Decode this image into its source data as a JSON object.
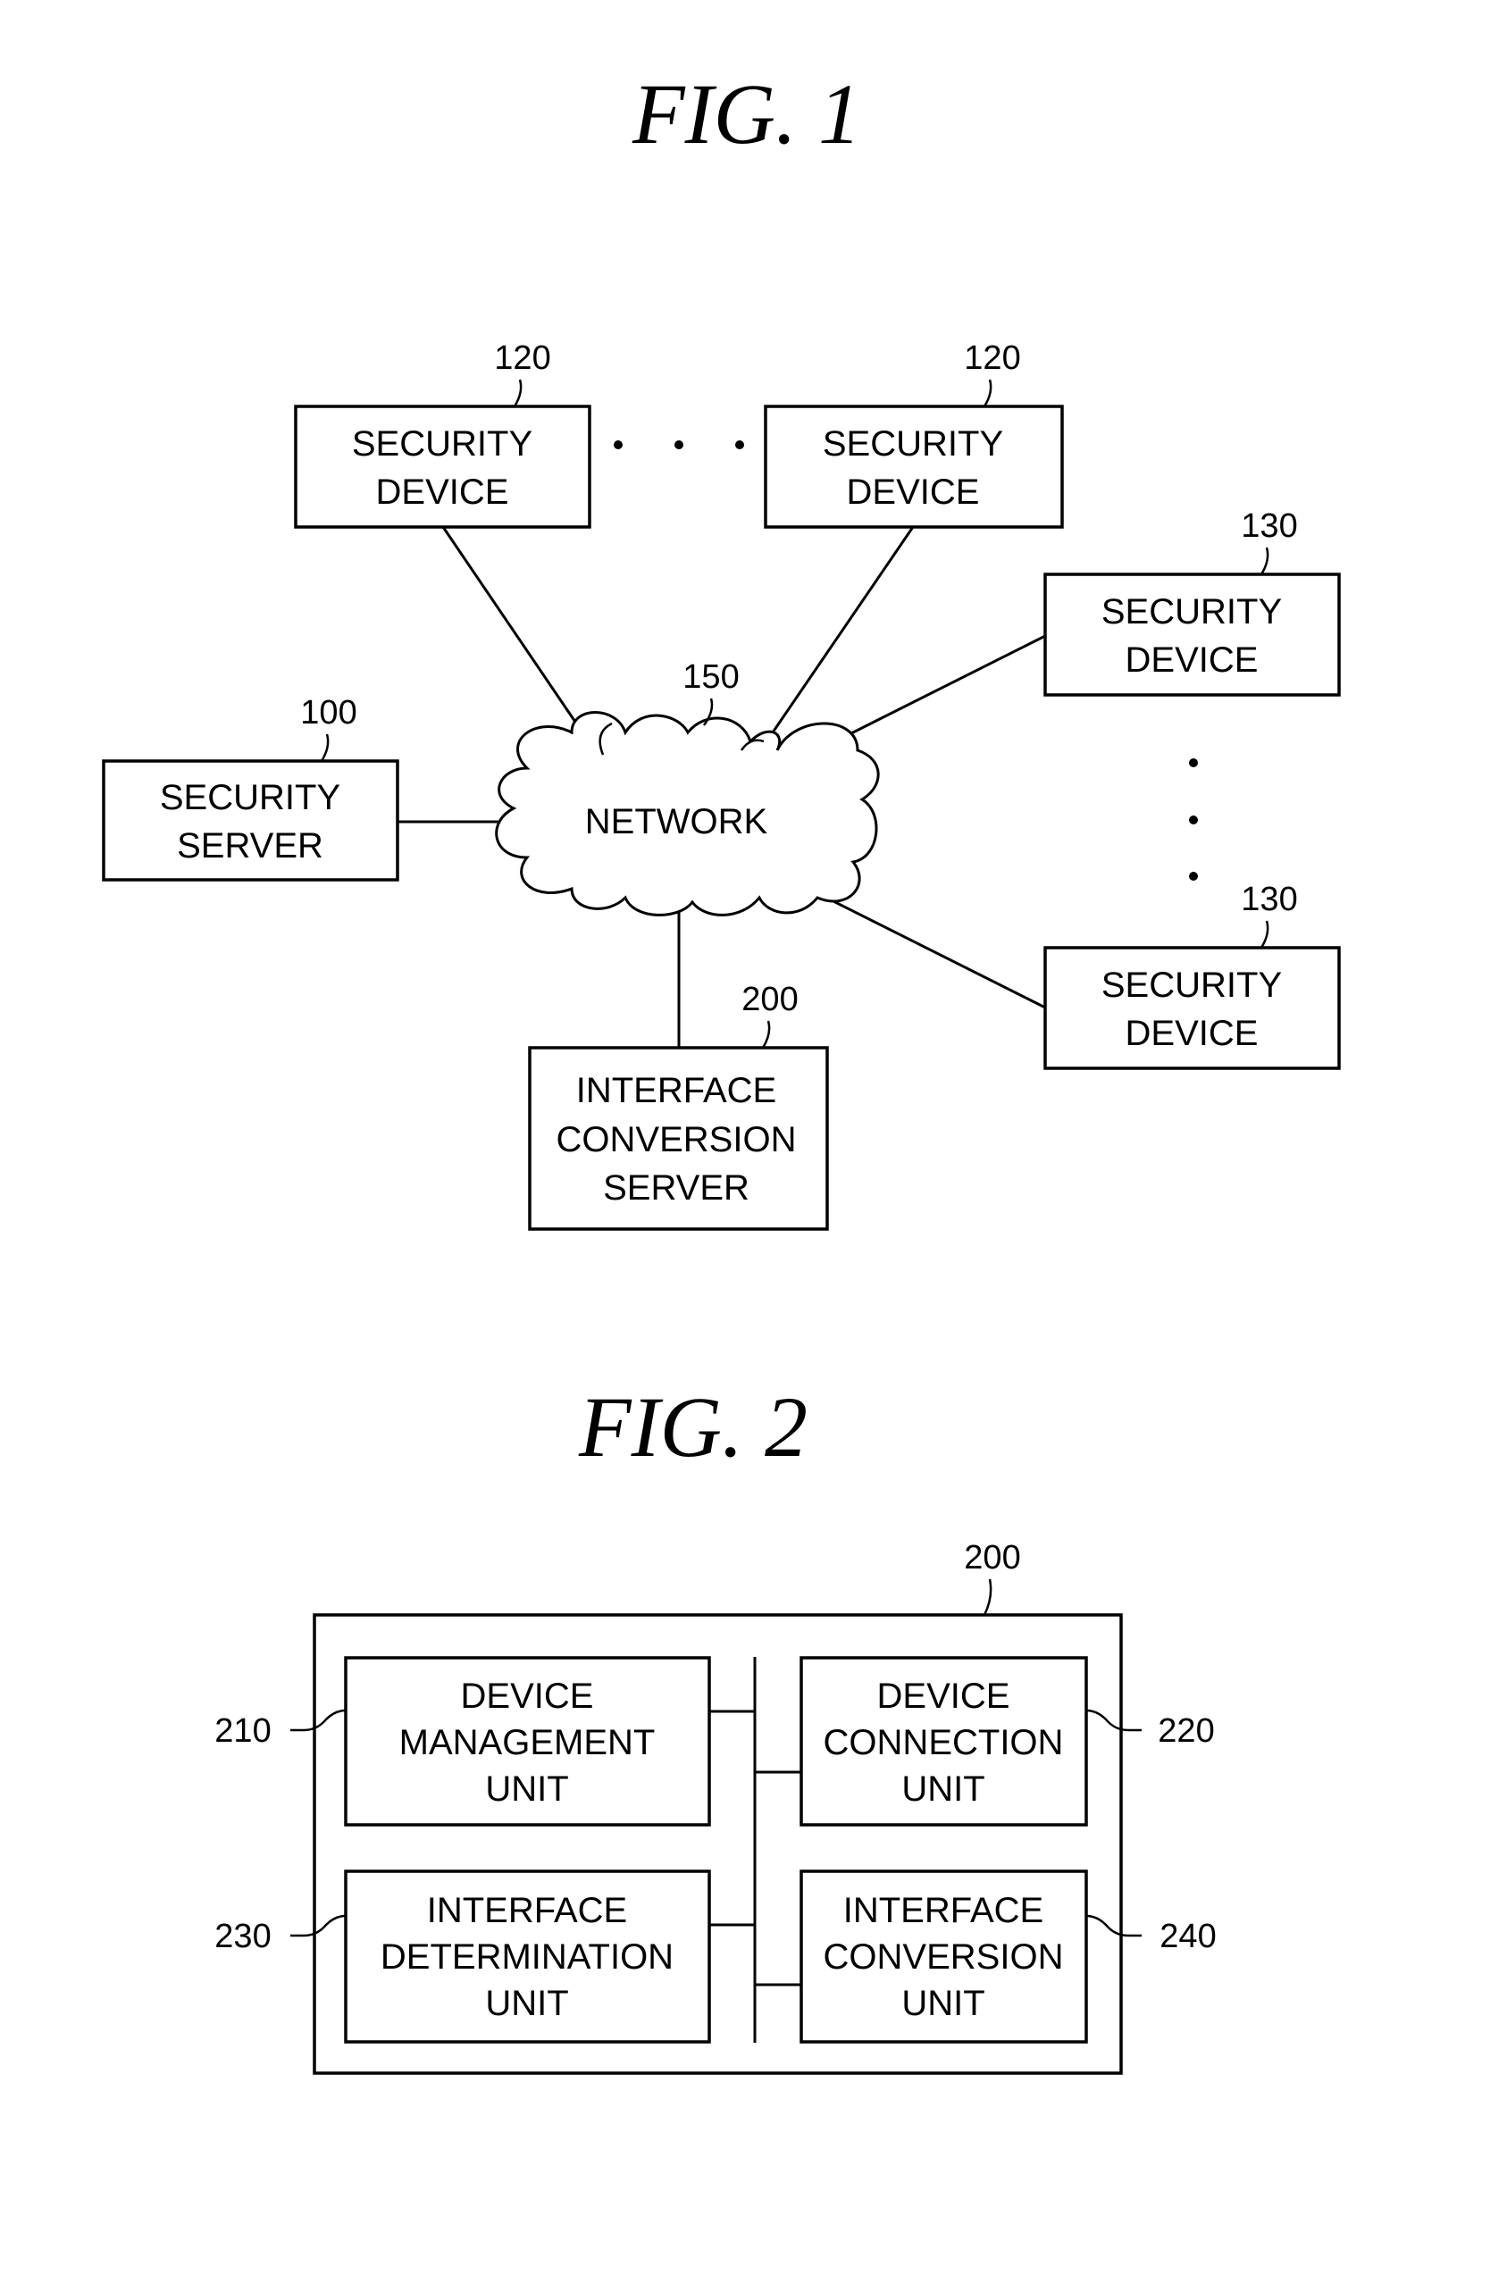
{
  "figures": [
    {
      "title": "FIG. 1",
      "nodes": {
        "security_device_120a": {
          "ref": "120",
          "lines": [
            "SECURITY",
            "DEVICE"
          ]
        },
        "security_device_120b": {
          "ref": "120",
          "lines": [
            "SECURITY",
            "DEVICE"
          ]
        },
        "security_device_130a": {
          "ref": "130",
          "lines": [
            "SECURITY",
            "DEVICE"
          ]
        },
        "security_device_130b": {
          "ref": "130",
          "lines": [
            "SECURITY",
            "DEVICE"
          ]
        },
        "security_server": {
          "ref": "100",
          "lines": [
            "SECURITY",
            "SERVER"
          ]
        },
        "network": {
          "ref": "150",
          "label": "NETWORK"
        },
        "interface_conversion_server": {
          "ref": "200",
          "lines": [
            "INTERFACE",
            "CONVERSION",
            "SERVER"
          ]
        }
      }
    },
    {
      "title": "FIG. 2",
      "container": {
        "ref": "200"
      },
      "units": {
        "device_management": {
          "ref": "210",
          "lines": [
            "DEVICE",
            "MANAGEMENT",
            "UNIT"
          ]
        },
        "device_connection": {
          "ref": "220",
          "lines": [
            "DEVICE",
            "CONNECTION",
            "UNIT"
          ]
        },
        "interface_determination": {
          "ref": "230",
          "lines": [
            "INTERFACE",
            "DETERMINATION",
            "UNIT"
          ]
        },
        "interface_conversion": {
          "ref": "240",
          "lines": [
            "INTERFACE",
            "CONVERSION",
            "UNIT"
          ]
        }
      }
    }
  ]
}
